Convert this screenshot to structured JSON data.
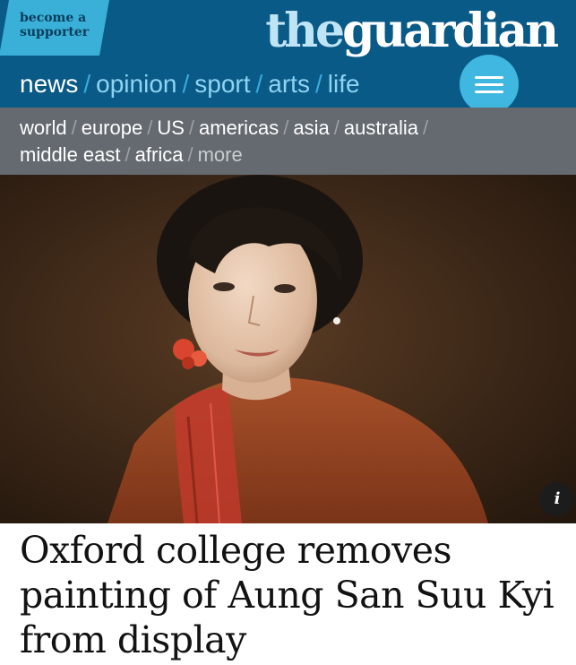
{
  "header": {
    "supporter_label": "become a supporter",
    "logo_the": "the",
    "logo_guardian": "guardian",
    "menu_icon": "hamburger-menu-icon",
    "colors": {
      "header_bg": "#0a5a87",
      "supporter_bg": "#3ab0d8",
      "menu_bg": "#3fb7e0"
    }
  },
  "pillars": [
    {
      "label": "news",
      "active": true
    },
    {
      "label": "opinion",
      "active": false
    },
    {
      "label": "sport",
      "active": false
    },
    {
      "label": "arts",
      "active": false
    },
    {
      "label": "life",
      "active": false
    }
  ],
  "subnav": {
    "items": [
      "world",
      "europe",
      "US",
      "americas",
      "asia",
      "australia",
      "middle east",
      "africa",
      "more"
    ],
    "color": "#646a70"
  },
  "hero": {
    "info_label": "i"
  },
  "article": {
    "headline": "Oxford college removes painting of Aung San Suu Kyi from display"
  }
}
